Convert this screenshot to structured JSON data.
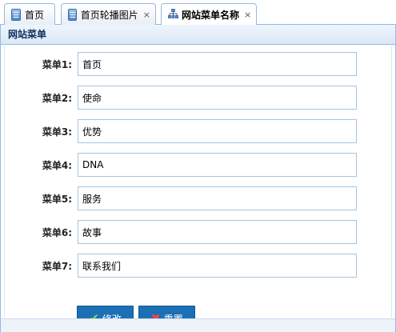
{
  "tabs": [
    {
      "label": "首页",
      "icon": "document-icon",
      "closable": false
    },
    {
      "label": "首页轮播图片",
      "icon": "document-icon",
      "closable": true
    },
    {
      "label": "网站菜单名称",
      "icon": "sitemap-icon",
      "closable": true
    }
  ],
  "close_glyph": "×",
  "panel": {
    "title": "网站菜单"
  },
  "form": {
    "rows": [
      {
        "label": "菜单1:",
        "value": "首页"
      },
      {
        "label": "菜单2:",
        "value": "使命"
      },
      {
        "label": "菜单3:",
        "value": "优势"
      },
      {
        "label": "菜单4:",
        "value": "DNA"
      },
      {
        "label": "菜单5:",
        "value": "服务"
      },
      {
        "label": "菜单6:",
        "value": "故事"
      },
      {
        "label": "菜单7:",
        "value": "联系我们"
      }
    ]
  },
  "buttons": {
    "submit": {
      "label": "修改",
      "icon": "checkmark-icon"
    },
    "reset": {
      "label": "重置",
      "icon": "cross-icon"
    }
  },
  "colors": {
    "accent": "#1b6fb5",
    "border": "#95b8e7",
    "header_bg": "#dbe8f5"
  }
}
